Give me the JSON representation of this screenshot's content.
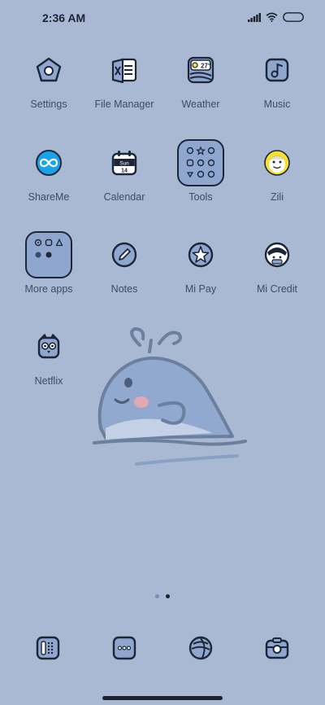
{
  "status_bar": {
    "time": "2:36 AM"
  },
  "apps": [
    {
      "label": "Settings",
      "icon": "pentagon-settings-icon"
    },
    {
      "label": "File Manager",
      "icon": "folder-file-icon"
    },
    {
      "label": "Weather",
      "icon": "weather-icon",
      "badge": "27°"
    },
    {
      "label": "Music",
      "icon": "music-note-icon"
    },
    {
      "label": "ShareMe",
      "icon": "infinity-share-icon"
    },
    {
      "label": "Calendar",
      "icon": "calendar-icon",
      "day": "Sun",
      "date": "14"
    },
    {
      "label": "Tools",
      "icon": "tools-folder-icon"
    },
    {
      "label": "Zili",
      "icon": "zili-face-icon"
    },
    {
      "label": "More apps",
      "icon": "more-apps-folder-icon"
    },
    {
      "label": "Notes",
      "icon": "pencil-notes-icon"
    },
    {
      "label": "Mi Pay",
      "icon": "star-pay-icon"
    },
    {
      "label": "Mi Credit",
      "icon": "credit-face-icon"
    },
    {
      "label": "Netflix",
      "icon": "owl-netflix-icon"
    }
  ],
  "dock": [
    {
      "icon": "phone-dialer-icon"
    },
    {
      "icon": "messages-icon"
    },
    {
      "icon": "browser-icon"
    },
    {
      "icon": "camera-icon"
    }
  ],
  "pages": {
    "total": 2,
    "current": 2
  },
  "colors": {
    "wallpaper": "#a9b9d4",
    "icon_stroke": "#1d2638",
    "icon_fill": "#8fa6cf",
    "label": "#3c4b66",
    "shareme_blue": "#1aa3e8",
    "zili_yellow": "#f6df2e"
  }
}
